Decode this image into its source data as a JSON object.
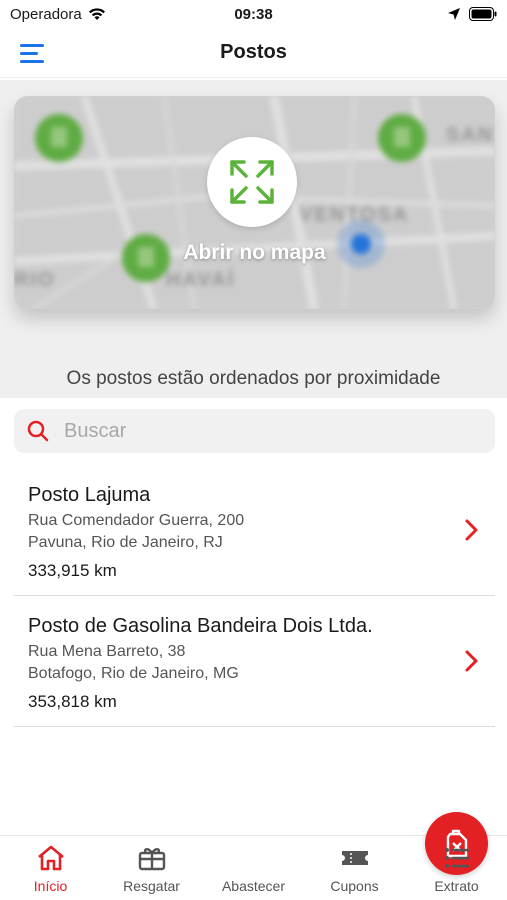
{
  "status_bar": {
    "carrier": "Operadora",
    "time": "09:38"
  },
  "nav": {
    "title": "Postos"
  },
  "map": {
    "open_label": "Abrir no mapa",
    "street_labels": [
      "SAN",
      "VENTOSA",
      "HAVAÍ",
      "RIO"
    ]
  },
  "sort_note": "Os postos estão ordenados por proximidade",
  "search": {
    "placeholder": "Buscar",
    "value": ""
  },
  "stations": [
    {
      "name": "Posto Lajuma",
      "address_line1": "Rua Comendador Guerra, 200",
      "address_line2": "Pavuna, Rio de Janeiro, RJ",
      "distance": "333,915 km"
    },
    {
      "name": "Posto de Gasolina Bandeira Dois Ltda.",
      "address_line1": "Rua Mena Barreto, 38",
      "address_line2": "Botafogo, Rio de Janeiro, MG",
      "distance": "353,818 km"
    }
  ],
  "tabs": [
    {
      "label": "Início",
      "icon": "home-icon",
      "active": true
    },
    {
      "label": "Resgatar",
      "icon": "gift-icon",
      "active": false
    },
    {
      "label": "Abastecer",
      "icon": "fuel-can-icon",
      "active": false
    },
    {
      "label": "Cupons",
      "icon": "ticket-icon",
      "active": false
    },
    {
      "label": "Extrato",
      "icon": "list-icon",
      "active": false
    }
  ],
  "colors": {
    "accent_red": "#e32024",
    "menu_blue": "#1a73e8",
    "marker_green": "#5cb33c",
    "location_blue": "#1a73e8"
  }
}
